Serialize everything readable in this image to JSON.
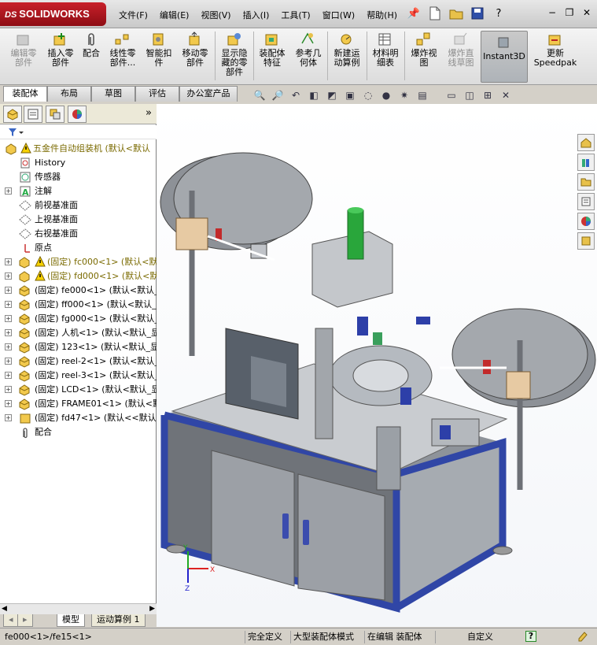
{
  "app": {
    "logo_prefix": "DS",
    "logo": "SOLIDWORKS"
  },
  "menu": [
    "文件(F)",
    "编辑(E)",
    "视图(V)",
    "插入(I)",
    "工具(T)",
    "窗口(W)",
    "帮助(H)"
  ],
  "quick_access": [
    "pin-icon",
    "new-document-icon",
    "open-folder-icon",
    "save-icon",
    "help-icon"
  ],
  "window_controls": {
    "minimize": "−",
    "restore": "❐",
    "close": "✕"
  },
  "commands": [
    {
      "label": "编辑零\n部件",
      "enabled": false
    },
    {
      "label": "插入零\n部件",
      "enabled": true
    },
    {
      "label": "配合",
      "enabled": true
    },
    {
      "label": "线性零\n部件...",
      "enabled": true
    },
    {
      "label": "智能扣\n件",
      "enabled": true
    },
    {
      "label": "移动零\n部件",
      "enabled": true
    },
    {
      "label": "显示隐\n藏的零\n部件",
      "enabled": true
    },
    {
      "label": "装配体\n特征",
      "enabled": true
    },
    {
      "label": "参考几\n何体",
      "enabled": true
    },
    {
      "label": "新建运\n动算例",
      "enabled": true
    },
    {
      "label": "材料明\n细表",
      "enabled": true
    },
    {
      "label": "爆炸视\n图",
      "enabled": true
    },
    {
      "label": "爆炸直\n线草图",
      "enabled": false
    },
    {
      "label": "Instant3D",
      "enabled": true,
      "active": true
    },
    {
      "label": "更新\nSpeedpak",
      "enabled": true
    }
  ],
  "command_tabs": [
    "装配体",
    "布局",
    "草图",
    "评估",
    "办公室产品"
  ],
  "active_command_tab": "装配体",
  "panel_tabs": [
    "feature-manager-icon",
    "property-manager-icon",
    "configuration-manager-icon",
    "display-manager-icon"
  ],
  "panel_expand": "»",
  "tree": [
    {
      "text": "五金件自动组装机 (默认<默认",
      "icon": "assembly-warning",
      "indent": 0,
      "expand": "",
      "warn": true
    },
    {
      "text": "History",
      "icon": "history",
      "indent": 1,
      "expand": ""
    },
    {
      "text": "传感器",
      "icon": "sensor",
      "indent": 1,
      "expand": ""
    },
    {
      "text": "注解",
      "icon": "annotation",
      "indent": 1,
      "expand": "+"
    },
    {
      "text": "前视基准面",
      "icon": "plane",
      "indent": 1,
      "expand": ""
    },
    {
      "text": "上视基准面",
      "icon": "plane",
      "indent": 1,
      "expand": ""
    },
    {
      "text": "右视基准面",
      "icon": "plane",
      "indent": 1,
      "expand": ""
    },
    {
      "text": "原点",
      "icon": "origin",
      "indent": 1,
      "expand": ""
    },
    {
      "text": "(固定) fc000<1> (默认<默",
      "icon": "comp-warn",
      "indent": 1,
      "expand": "+",
      "fixed": true
    },
    {
      "text": "(固定) fd000<1> (默认<默",
      "icon": "comp-warn",
      "indent": 1,
      "expand": "+",
      "fixed": true
    },
    {
      "text": "(固定) fe000<1> (默认<默认_",
      "icon": "comp",
      "indent": 1,
      "expand": "+"
    },
    {
      "text": "(固定) ff000<1> (默认<默认_",
      "icon": "comp",
      "indent": 1,
      "expand": "+"
    },
    {
      "text": "(固定) fg000<1> (默认<默认_",
      "icon": "comp",
      "indent": 1,
      "expand": "+"
    },
    {
      "text": "(固定) 人机<1> (默认<默认_显",
      "icon": "comp",
      "indent": 1,
      "expand": "+"
    },
    {
      "text": "(固定) 123<1> (默认<默认_显",
      "icon": "comp",
      "indent": 1,
      "expand": "+"
    },
    {
      "text": "(固定) reel-2<1> (默认<默认_",
      "icon": "comp",
      "indent": 1,
      "expand": "+"
    },
    {
      "text": "(固定) reel-3<1> (默认<默认_",
      "icon": "comp",
      "indent": 1,
      "expand": "+"
    },
    {
      "text": "(固定) LCD<1> (默认<默认_显",
      "icon": "comp",
      "indent": 1,
      "expand": "+"
    },
    {
      "text": "(固定) FRAME01<1> (默认<默",
      "icon": "comp",
      "indent": 1,
      "expand": "+"
    },
    {
      "text": "(固定) fd47<1> (默认<<默认>",
      "icon": "comp-yellow",
      "indent": 1,
      "expand": "+"
    },
    {
      "text": "配合",
      "icon": "mates",
      "indent": 1,
      "expand": ""
    }
  ],
  "bottom_tabs": [
    "模型",
    "运动算例 1"
  ],
  "active_bottom_tab": "模型",
  "task_pane": [
    "home-icon",
    "design-library-icon",
    "file-explorer-icon",
    "search-icon",
    "appearances-icon",
    "custom-properties-icon"
  ],
  "status": {
    "path": "fe000<1>/fe15<1>",
    "definition": "完全定义",
    "mode": "大型装配体模式",
    "editing": "在编辑 装配体",
    "units": "自定义",
    "help": "?"
  },
  "triad": {
    "x": "X",
    "y": "Y",
    "z": "Z"
  },
  "colors": {
    "frame_blue": "#3046a6",
    "panel_gray": "#9da2a8",
    "green_cylinder": "#29a63b",
    "brand_red": "#c8202a"
  }
}
